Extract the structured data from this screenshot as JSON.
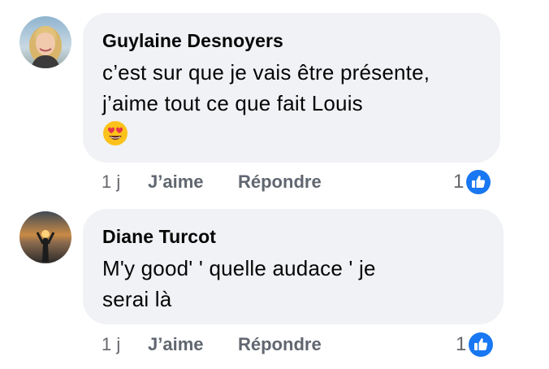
{
  "comments": [
    {
      "author": "Guylaine Desnoyers",
      "line1": "c’est sur que je vais être présente,",
      "line2": "j’aime tout ce que fait Louis",
      "emoji": "heart-eyes-emoji",
      "avatar": "avatar-photo-blonde-woman",
      "time": "1 j",
      "like_label": "J’aime",
      "reply_label": "Répondre",
      "reaction_count": "1",
      "reaction_icon": "thumbs-up-icon"
    },
    {
      "author": "Diane Turcot",
      "line1": "M'y good' ' quelle audace ' je",
      "line2": "serai là",
      "avatar": "avatar-photo-sunset",
      "time": "1 j",
      "like_label": "J’aime",
      "reply_label": "Répondre",
      "reaction_count": "1",
      "reaction_icon": "thumbs-up-icon"
    }
  ],
  "colors": {
    "bubble": "#f0f2f5",
    "like_blue": "#1877f2",
    "meta_text": "#65676b"
  }
}
